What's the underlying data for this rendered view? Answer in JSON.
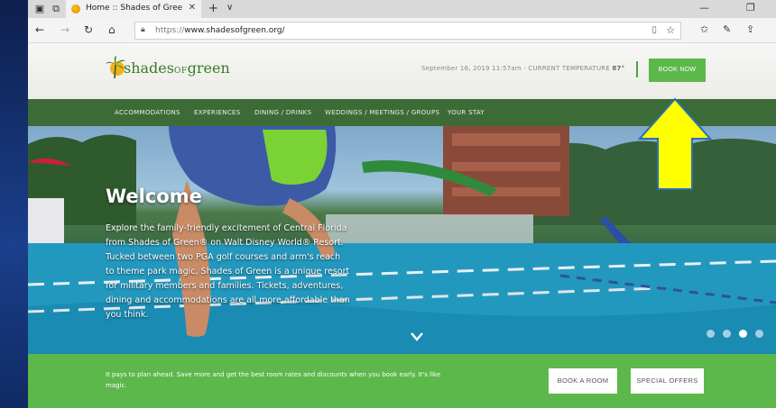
{
  "browser": {
    "tab_title": "Home :: Shades of Gree",
    "tab_close": "✕",
    "new_tab": "+",
    "tab_menu": "∨",
    "url_scheme": "https://",
    "url_host": "www.shadesofgreen.org/",
    "min_glyph": "—",
    "restore_glyph": "❐"
  },
  "header": {
    "logo_main": "shades",
    "logo_of": "OF",
    "logo_green": "green",
    "datetime": "September 16, 2019 11:57am",
    "temp_label": "- CURRENT TEMPERATURE",
    "temp_value": "87°",
    "book_now": "BOOK NOW"
  },
  "nav": {
    "items": [
      "ACCOMMODATIONS",
      "EXPERIENCES",
      "DINING / DRINKS",
      "WEDDINGS / MEETINGS / GROUPS",
      "YOUR STAY"
    ]
  },
  "hero": {
    "title": "Welcome",
    "body": "Explore the family-friendly excitement of Central Florida from Shades of Green® on Walt Disney World® Resort. Tucked between two PGA golf courses and arm's reach to theme park magic, Shades of Green is a unique resort for military members and families. Tickets, adventures, dining and accommodations are all more affordable than you think.",
    "slides": 4,
    "active_slide": 3
  },
  "promo": {
    "text": "It pays to plan ahead. Save more and get the best room rates and discounts when you book early. It's like magic.",
    "book_room": "BOOK A ROOM",
    "special_offers": "SPECIAL OFFERS"
  },
  "colors": {
    "brand_green": "#5cb84a",
    "nav_green": "#3d6b38",
    "annotation_yellow": "#ffff00"
  },
  "icons": [
    "tab-actions-icon",
    "tab-switch-icon",
    "back-icon",
    "forward-icon",
    "refresh-icon",
    "home-icon",
    "lock-icon",
    "reading-view-icon",
    "favorite-star-icon",
    "favorites-list-icon",
    "pen-icon",
    "share-icon",
    "chevron-down-icon",
    "arrow-annotation-icon"
  ]
}
